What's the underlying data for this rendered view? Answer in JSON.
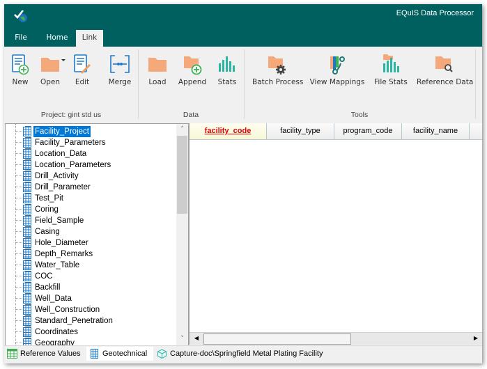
{
  "app": {
    "title": "EQuIS Data Processor",
    "logo_icon": "checkmark-globe-icon"
  },
  "menu_tabs": [
    {
      "label": "File",
      "active": false
    },
    {
      "label": "Home",
      "active": false
    },
    {
      "label": "Link",
      "active": true
    }
  ],
  "ribbon": {
    "groups": [
      {
        "label": "Project: gint std us",
        "buttons": [
          {
            "label": "New",
            "icon": "new-document-icon"
          },
          {
            "label": "Open",
            "icon": "folder-icon",
            "has_dropdown": true
          },
          {
            "label": "Edit",
            "icon": "edit-document-icon"
          },
          {
            "label": "Merge",
            "icon": "merge-icon"
          }
        ]
      },
      {
        "label": "Data",
        "buttons": [
          {
            "label": "Load",
            "icon": "folder-icon"
          },
          {
            "label": "Append",
            "icon": "folder-add-icon"
          },
          {
            "label": "Stats",
            "icon": "bar-chart-icon"
          }
        ]
      },
      {
        "label": "Tools",
        "buttons": [
          {
            "label": "Batch Process",
            "icon": "folder-gear-icon"
          },
          {
            "label": "View Mappings",
            "icon": "mappings-icon"
          },
          {
            "label": "File Stats",
            "icon": "file-stats-icon"
          },
          {
            "label": "Reference Data",
            "icon": "folder-search-icon"
          }
        ]
      }
    ]
  },
  "tree": {
    "selected": "Facility_Project",
    "items": [
      "Facility_Project",
      "Facility_Parameters",
      "Location_Data",
      "Location_Parameters",
      "Drill_Activity",
      "Drill_Parameter",
      "Test_Pit",
      "Coring",
      "Field_Sample",
      "Casing",
      "Hole_Diameter",
      "Depth_Remarks",
      "Water_Table",
      "COC",
      "Backfill",
      "Well_Data",
      "Well_Construction",
      "Standard_Penetration",
      "Coordinates",
      "Geography"
    ]
  },
  "grid": {
    "columns": [
      {
        "label": "facility_code",
        "key": true
      },
      {
        "label": "facility_type",
        "key": false
      },
      {
        "label": "program_code",
        "key": false
      },
      {
        "label": "facility_name",
        "key": false
      }
    ],
    "rows": []
  },
  "bottom_tabs": [
    {
      "label": "Reference Values",
      "icon": "table-icon",
      "active": false
    },
    {
      "label": "Geotechnical",
      "icon": "table-icon",
      "active": true
    },
    {
      "label": "Capture-doc\\Springfield Metal Plating Facility",
      "icon": "cube-icon",
      "active": false
    }
  ],
  "colors": {
    "titlebar": "#006060",
    "selection": "#0078d7",
    "key_column_text": "#e00000",
    "folder": "#f5a97a",
    "teal_accent": "#2bb5a5",
    "blue_icon": "#1e78c8",
    "green_add": "#3cb050"
  }
}
